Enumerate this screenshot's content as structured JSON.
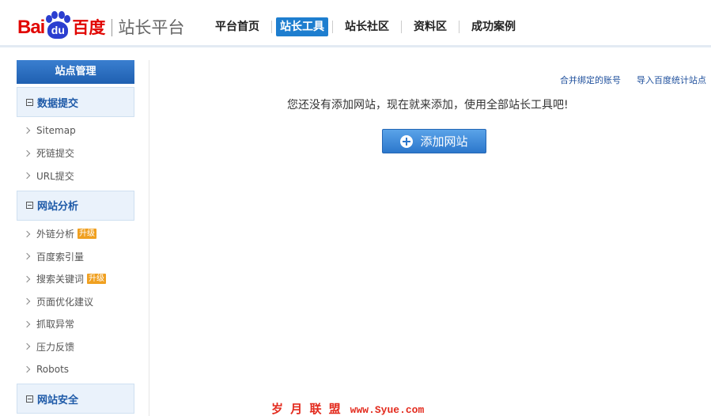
{
  "header": {
    "logo_bai": "Bai",
    "logo_du": "du",
    "logo_cn": "百度",
    "platform": "站长平台",
    "nav": [
      "平台首页",
      "站长工具",
      "站长社区",
      "资料区",
      "成功案例"
    ],
    "active_nav_index": 1
  },
  "sidebar": {
    "header": "站点管理",
    "groups": [
      {
        "title": "数据提交",
        "items": [
          {
            "label": "Sitemap"
          },
          {
            "label": "死链提交"
          },
          {
            "label": "URL提交"
          }
        ]
      },
      {
        "title": "网站分析",
        "items": [
          {
            "label": "外链分析",
            "badge": "升级"
          },
          {
            "label": "百度索引量"
          },
          {
            "label": "搜索关键词",
            "badge": "升级"
          },
          {
            "label": "页面优化建议"
          },
          {
            "label": "抓取异常"
          },
          {
            "label": "压力反馈"
          },
          {
            "label": "Robots"
          }
        ]
      },
      {
        "title": "网站安全",
        "items": []
      }
    ]
  },
  "main": {
    "links": [
      "合并绑定的账号",
      "导入百度统计站点"
    ],
    "empty_message": "您还没有添加网站，现在就来添加，使用全部站长工具吧!",
    "add_button": "添加网站"
  },
  "watermark": {
    "text": "岁 月 联 盟",
    "url": "www.Syue.com"
  },
  "colors": {
    "brand_red": "#e10602",
    "brand_blue": "#2b3ed0",
    "accent": "#1e7ecf",
    "badge": "#f0a020"
  },
  "icons": {
    "logo": "baidu-paw-icon",
    "add": "plus-circle-icon",
    "collapse": "minus-box-icon",
    "chevron": "chevron-right-icon"
  }
}
